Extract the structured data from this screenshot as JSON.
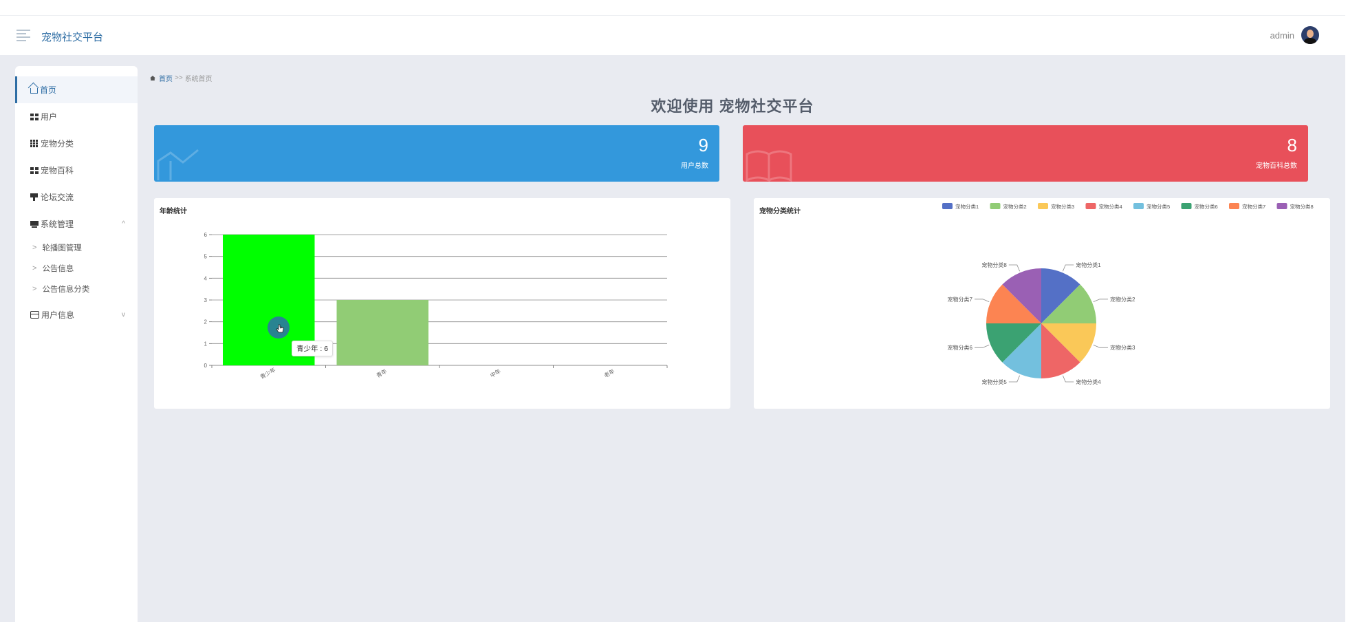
{
  "app": {
    "title": "宠物社交平台"
  },
  "header": {
    "username": "admin"
  },
  "sidebar": {
    "items": [
      {
        "label": "首页",
        "icon": "home-icon"
      },
      {
        "label": "用户",
        "icon": "grid-icon"
      },
      {
        "label": "宠物分类",
        "icon": "grid-icon"
      },
      {
        "label": "宠物百科",
        "icon": "grid-icon"
      },
      {
        "label": "论坛交流",
        "icon": "board-icon"
      },
      {
        "label": "系统管理",
        "icon": "monitor-icon",
        "chevron": "^"
      },
      {
        "label": "轮播图管理"
      },
      {
        "label": "公告信息"
      },
      {
        "label": "公告信息分类"
      },
      {
        "label": "用户信息",
        "icon": "card-icon",
        "chevron": "v"
      }
    ]
  },
  "breadcrumb": {
    "home": "首页",
    "separator": ">>",
    "current": "系统首页"
  },
  "welcome": "欢迎使用 宠物社交平台",
  "stats": [
    {
      "value": "9",
      "label": "用户总数",
      "color": "#3398dc"
    },
    {
      "value": "8",
      "label": "宠物百科总数",
      "color": "#e8505a"
    }
  ],
  "age_chart_title": "年龄统计",
  "pet_chart_title": "宠物分类统计",
  "tooltip": "青少年 : 6",
  "chart_data": [
    {
      "type": "bar",
      "title": "年龄统计",
      "categories": [
        "青少年",
        "青年",
        "中年",
        "老年"
      ],
      "values": [
        6,
        3,
        0,
        0
      ],
      "colors": [
        "#00ff00",
        "#91cc75",
        "#5470c6",
        "#5470c6"
      ],
      "ylim": [
        0,
        6
      ],
      "yticks": [
        0,
        1,
        2,
        3,
        4,
        5,
        6
      ],
      "grid": true
    },
    {
      "type": "pie",
      "title": "宠物分类统计",
      "labels": [
        "宠物分类1",
        "宠物分类2",
        "宠物分类3",
        "宠物分类4",
        "宠物分类5",
        "宠物分类6",
        "宠物分类7",
        "宠物分类8"
      ],
      "values": [
        1,
        1,
        1,
        1,
        1,
        1,
        1,
        1
      ],
      "colors": [
        "#5470c6",
        "#91cc75",
        "#fac858",
        "#ee6666",
        "#73c0de",
        "#3ba272",
        "#fc8452",
        "#9a60b4"
      ],
      "legend": "top-right"
    }
  ]
}
